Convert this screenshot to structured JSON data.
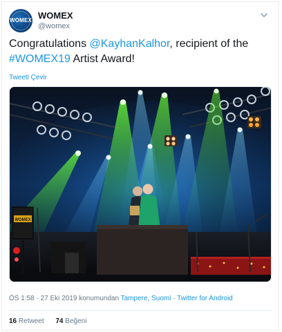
{
  "account": {
    "display_name": "WOMEX",
    "handle": "@womex",
    "avatar_text": "WOMEX"
  },
  "tweet": {
    "text_prefix": "Congratulations ",
    "mention": "@KayhanKalhor",
    "text_middle": ", recipient of the ",
    "hashtag": "#WOMEX19",
    "text_suffix": " Artist Award!",
    "translate_label": "Tweeti Çevir"
  },
  "meta": {
    "time": "ÖS 1:58",
    "separator1": " · ",
    "date": "27 Eki 2019",
    "location_prefix": " konumundan ",
    "location": "Tampere, Suomi",
    "separator2": " · ",
    "source": "Twitter for Android"
  },
  "stats": {
    "retweets_count": "16",
    "retweets_label": "Retweet",
    "likes_count": "74",
    "likes_label": "Beğeni"
  },
  "media": {
    "stage_sign_text": "WOMEX"
  },
  "colors": {
    "link": "#1b95e0",
    "muted": "#657786",
    "text": "#14171a"
  }
}
